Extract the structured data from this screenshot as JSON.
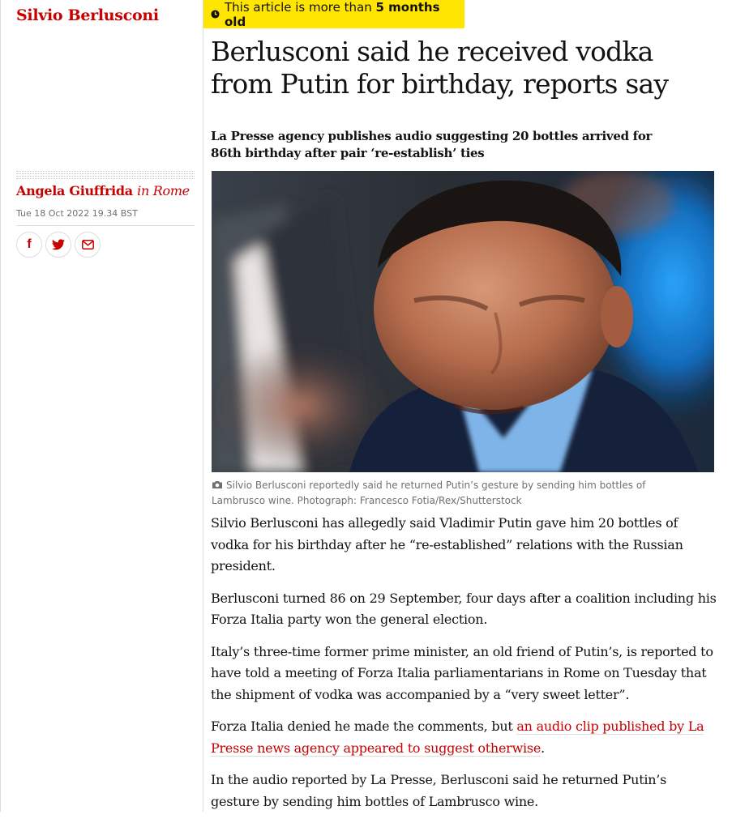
{
  "section": {
    "label": "Silvio Berlusconi"
  },
  "byline": {
    "author": "Angela Giuffrida",
    "location": "in Rome"
  },
  "dateline": "Tue 18 Oct 2022 19.34 BST",
  "share": {
    "icons": [
      "facebook-icon",
      "twitter-icon",
      "email-icon"
    ],
    "facebook_glyph": "f"
  },
  "age_warning": {
    "prefix": "This article is more than",
    "age": "5 months old"
  },
  "headline": "Berlusconi said he received vodka from Putin for birthday, reports say",
  "standfirst": "La Presse agency publishes audio suggesting 20 bottles arrived for 86th birthday after pair ‘re-establish’ ties",
  "image": {
    "caption": "Silvio Berlusconi reportedly said he returned Putin’s gesture by sending him bottles of Lambrusco wine. Photograph: Francesco Fotia/Rex/Shutterstock"
  },
  "body": {
    "p1": "Silvio Berlusconi has allegedly said Vladimir Putin gave him 20 bottles of vodka for his birthday after he “re-established” relations with the Russian president.",
    "p2": "Berlusconi turned 86 on 29 September, four days after a coalition including his Forza Italia party won the general election.",
    "p3": "Italy’s three-time former prime minister, an old friend of Putin’s, is reported to have told a meeting of Forza Italia parliamentarians in Rome on Tuesday that the shipment of vodka was accompanied by a “very sweet letter”.",
    "p4_before": "Forza Italia denied he made the comments, but ",
    "p4_link": "an audio clip published by La Presse news agency appeared to suggest otherwise",
    "p4_after": ".",
    "p5": "In the audio reported by La Presse, Berlusconi said he returned Putin’s gesture by sending him bottles of Lambrusco wine."
  },
  "colors": {
    "accent": "#c70000",
    "warning_bg": "#ffe500",
    "text": "#121212",
    "muted": "#707070",
    "rule": "#dcdcdc"
  }
}
